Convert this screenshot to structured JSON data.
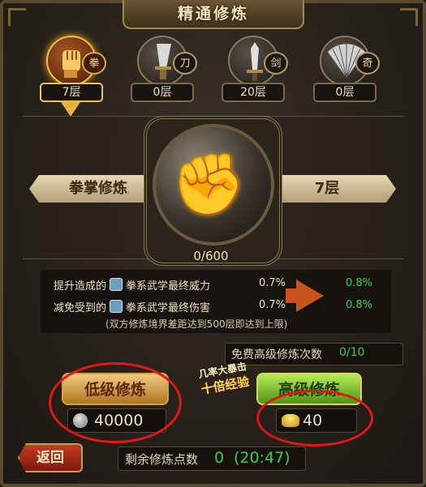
{
  "title": "精通修炼",
  "tabs": [
    {
      "badge": "拳",
      "level": "7层",
      "icon": "fist-icon",
      "active": true
    },
    {
      "badge": "刀",
      "level": "0层",
      "icon": "broadsword-icon",
      "active": false
    },
    {
      "badge": "剑",
      "level": "20层",
      "icon": "sword-icon",
      "active": false
    },
    {
      "badge": "奇",
      "level": "0层",
      "icon": "fan-icon",
      "active": false
    }
  ],
  "current": {
    "name": "拳掌修炼",
    "level": "7层",
    "progress": "0/600",
    "emblem": "✊"
  },
  "stats": {
    "row1": {
      "label": "提升造成的",
      "attr": "拳系武学最终威力",
      "before": "0.7%",
      "after": "0.8%"
    },
    "row2": {
      "label": "减免受到的",
      "attr": "拳系武学最终伤害",
      "before": "0.7%",
      "after": "0.8%"
    },
    "note": "(双方修炼境界差距达到500层即达到上限)"
  },
  "free_advanced": {
    "label": "免费高级修炼次数",
    "count": "0/10"
  },
  "buttons": {
    "low": "低级修炼",
    "high": "高级修炼",
    "back": "返回"
  },
  "costs": {
    "low": "40000",
    "high": "40"
  },
  "promo": {
    "line1": "几率大暴击",
    "line2": "十倍经验"
  },
  "remaining": {
    "label": "剩余修炼点数",
    "points": "0",
    "timer": "(20:47)"
  },
  "colors": {
    "accent_gold": "#f1c14c",
    "green": "#43c94e",
    "annotation_red": "#e01818"
  }
}
